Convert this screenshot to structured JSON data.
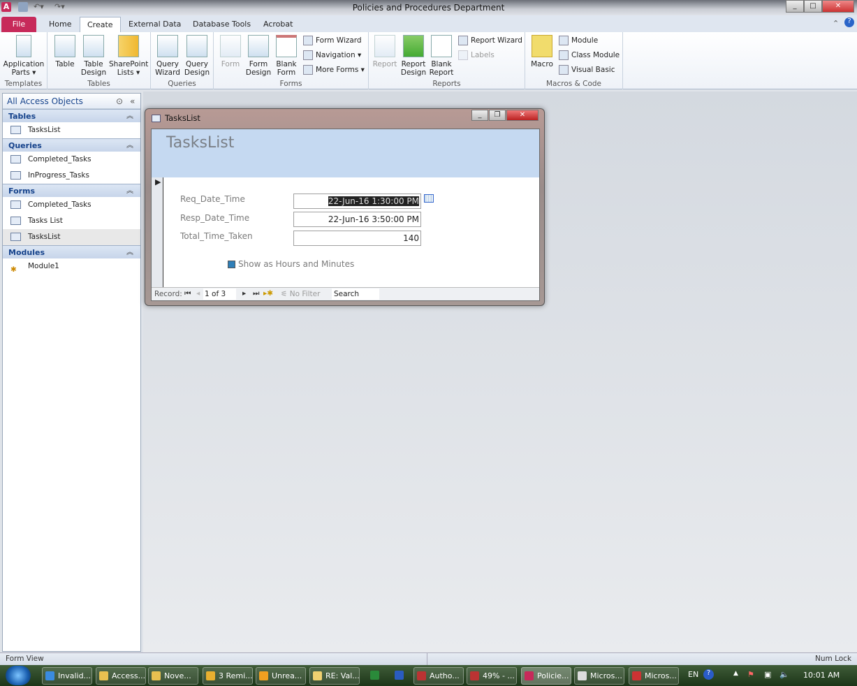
{
  "window": {
    "title": "Policies and Procedures Department"
  },
  "tabs": [
    "File",
    "Home",
    "Create",
    "External Data",
    "Database Tools",
    "Acrobat"
  ],
  "ribbon": {
    "templates": {
      "label": "Templates",
      "application_parts": "Application Parts ▾"
    },
    "tables": {
      "label": "Tables",
      "table": "Table",
      "table_design": "Table Design",
      "sharepoint_lists": "SharePoint Lists ▾"
    },
    "queries": {
      "label": "Queries",
      "query_wizard": "Query Wizard",
      "query_design": "Query Design"
    },
    "forms": {
      "label": "Forms",
      "form": "Form",
      "form_design": "Form Design",
      "blank_form": "Blank Form",
      "form_wizard": "Form Wizard",
      "navigation": "Navigation ▾",
      "more_forms": "More Forms ▾"
    },
    "reports": {
      "label": "Reports",
      "report": "Report",
      "report_design": "Report Design",
      "blank_report": "Blank Report",
      "report_wizard": "Report Wizard",
      "labels": "Labels"
    },
    "macros": {
      "label": "Macros & Code",
      "macro": "Macro",
      "module": "Module",
      "class_module": "Class Module",
      "visual_basic": "Visual Basic"
    }
  },
  "nav": {
    "header": "All Access Objects",
    "sections": [
      {
        "title": "Tables",
        "items": [
          "TasksList"
        ]
      },
      {
        "title": "Queries",
        "items": [
          "Completed_Tasks",
          "InProgress_Tasks"
        ]
      },
      {
        "title": "Forms",
        "items": [
          "Completed_Tasks",
          "Tasks List",
          "TasksList"
        ]
      },
      {
        "title": "Modules",
        "items": [
          "Module1"
        ]
      }
    ]
  },
  "form": {
    "window_title": "TasksList",
    "header": "TasksList",
    "fields": [
      {
        "label": "Req_Date_Time",
        "value": "22-Jun-16 1:30:00 PM"
      },
      {
        "label": "Resp_Date_Time",
        "value": "22-Jun-16 3:50:00 PM"
      },
      {
        "label": "Total_Time_Taken",
        "value": "140"
      }
    ],
    "checkbox_label": "Show as Hours and Minutes",
    "record_label": "Record:",
    "record_pos": "1 of 3",
    "filter": "No Filter",
    "search": "Search"
  },
  "status": {
    "left": "Form View",
    "right": "Num Lock"
  },
  "taskbar": {
    "items": [
      "Invalid...",
      "Access...",
      "Nove...",
      "3 Remi...",
      "Unrea...",
      "RE: Val...",
      "",
      "",
      "Autho...",
      "49% - ...",
      "Policie...",
      "Micros...",
      "Micros..."
    ],
    "lang": "EN",
    "clock": "10:01 AM"
  }
}
